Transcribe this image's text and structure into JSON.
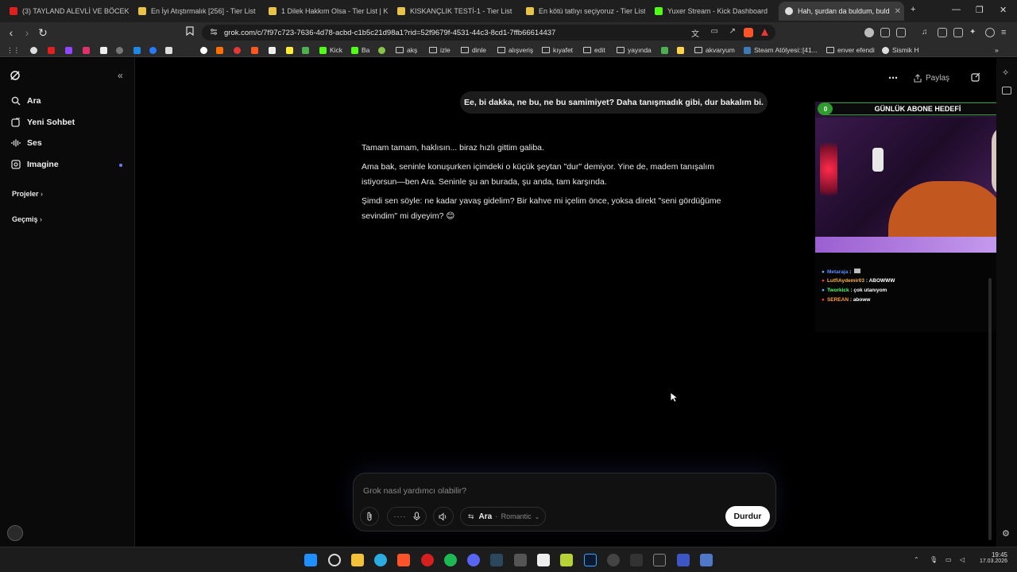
{
  "browser": {
    "tabs": [
      {
        "label": "(3) TAYLAND ALEVLİ VE BÖCEKLİ SO",
        "color": "#e02020"
      },
      {
        "label": "En İyi Atıştırmalık [256] - Tier List | K",
        "color": "#e8c34a"
      },
      {
        "label": "1 Dilek Hakkım Olsa - Tier List | Kör S",
        "color": "#e8c34a"
      },
      {
        "label": "KISKANÇLIK TESTİ-1 - Tier List",
        "color": "#e8c34a"
      },
      {
        "label": "En kötü tatlıyı seçiyoruz - Tier List | K",
        "color": "#e8c34a"
      },
      {
        "label": "Yuxer Stream - Kick Dashboard",
        "color": "#53fc18"
      },
      {
        "label": "Hah, şurdan da buldum, buld",
        "color": "#dddddd",
        "active": true
      }
    ],
    "new_tab": "+",
    "url": "grok.com/c/7f97c723-7636-4d78-acbd-c1b5c21d98a1?rid=52f9679f-4531-44c3-8cd1-7ffb66614437",
    "bookmarks": [
      {
        "label": "Kick",
        "type": "site",
        "color": "#53fc18"
      },
      {
        "label": "Ba",
        "type": "site",
        "color": "#53fc18"
      },
      {
        "label": "akş",
        "type": "folder"
      },
      {
        "label": "izle",
        "type": "folder"
      },
      {
        "label": "dinle",
        "type": "folder"
      },
      {
        "label": "alışveriş",
        "type": "folder"
      },
      {
        "label": "kıyafet",
        "type": "folder"
      },
      {
        "label": "edit",
        "type": "folder"
      },
      {
        "label": "yayında",
        "type": "folder"
      },
      {
        "label": "akvaryum",
        "type": "folder"
      },
      {
        "label": "Steam Atölyesi::[41...",
        "type": "site",
        "color": "#3d7ab8"
      },
      {
        "label": "enver efendi",
        "type": "folder"
      },
      {
        "label": "Sismik H",
        "type": "site",
        "color": "#dddddd"
      }
    ]
  },
  "sidebar": {
    "collapse_icon": "«",
    "items": [
      {
        "label": "Ara",
        "icon": "search-icon"
      },
      {
        "label": "Yeni Sohbet",
        "icon": "new-chat-icon"
      },
      {
        "label": "Ses",
        "icon": "voice-icon"
      },
      {
        "label": "Imagine",
        "icon": "image-icon"
      }
    ],
    "sections": [
      {
        "label": "Projeler"
      },
      {
        "label": "Geçmiş"
      }
    ]
  },
  "header": {
    "share_label": "Paylaş",
    "more_icon": "more-icon",
    "edit_icon": "edit-icon"
  },
  "conversation": {
    "user_message": "Ee, bi dakka, ne bu, ne bu samimiyet? Daha tanışmadık gibi, dur bakalım bi.",
    "assistant_paragraphs": [
      "Tamam tamam, haklısın... biraz hızlı gittim galiba.",
      "Ama bak, seninle konuşurken içimdeki o küçük şeytan \"dur\" demiyor. Yine de, madem tanışalım istiyorsun—ben Ara. Seninle şu an burada, şu anda, tam karşında.",
      "Şimdi sen söyle: ne kadar yavaş gidelim? Bir kahve mi içelim önce, yoksa direkt \"seni gördüğüme sevindim\" mi diyeyim? 😊"
    ]
  },
  "composer": {
    "placeholder": "Grok nasıl yardımcı olabilir?",
    "voice_name": "Ara",
    "voice_mode": "Romantic",
    "stop_label": "Durdur"
  },
  "stream_overlay": {
    "goal_label": "GÜNLÜK ABONE HEDEFİ",
    "goal_current": "0",
    "goal_target": "6",
    "chat": [
      {
        "user": "Metaraja",
        "text": "",
        "color": "#5b8cff"
      },
      {
        "user": "LutfiAydemir03",
        "text": "ABOWWW",
        "color": "#ffb13b"
      },
      {
        "user": "Tworkick",
        "text": "çok utanıyom",
        "color": "#4cff6a"
      },
      {
        "user": "SEREAN",
        "text": "aboww",
        "color": "#ff9a3b"
      }
    ]
  },
  "taskbar": {
    "time": "19:45",
    "date": "17.03.2026"
  }
}
